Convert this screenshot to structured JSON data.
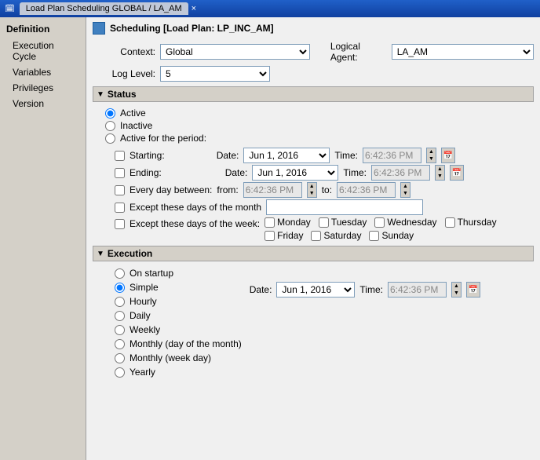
{
  "titleBar": {
    "tab": "Load Plan Scheduling GLOBAL / LA_AM",
    "closeLabel": "×"
  },
  "sidebar": {
    "sectionTitle": "Definition",
    "items": [
      {
        "id": "execution-cycle",
        "label": "Execution Cycle"
      },
      {
        "id": "variables",
        "label": "Variables"
      },
      {
        "id": "privileges",
        "label": "Privileges"
      },
      {
        "id": "version",
        "label": "Version"
      }
    ]
  },
  "pageTitle": "Scheduling [Load Plan: LP_INC_AM]",
  "form": {
    "contextLabel": "Context:",
    "contextValue": "Global",
    "logicalAgentLabel": "Logical Agent:",
    "logicalAgentValue": "LA_AM",
    "logLevelLabel": "Log Level:",
    "logLevelValue": "5"
  },
  "status": {
    "sectionTitle": "Status",
    "radioActive": "Active",
    "radioInactive": "Inactive",
    "radioActivePeriod": "Active for the period:",
    "startingLabel": "Starting:",
    "endingLabel": "Ending:",
    "everyDayLabel": "Every day between:",
    "exceptMonthLabel": "Except these days of the month",
    "exceptWeekLabel": "Except these days of the week:",
    "dateLabel": "Date:",
    "timeLabel": "Time:",
    "fromLabel": "from:",
    "toLabel": "to:",
    "dateValue": "Jun 1, 2016",
    "timeValue": "6:42:36 PM",
    "days": [
      "Monday",
      "Tuesday",
      "Wednesday",
      "Thursday",
      "Friday",
      "Saturday",
      "Sunday"
    ]
  },
  "execution": {
    "sectionTitle": "Execution",
    "options": [
      "On startup",
      "Simple",
      "Hourly",
      "Daily",
      "Weekly",
      "Monthly (day of the month)",
      "Monthly (week day)",
      "Yearly"
    ],
    "selectedOption": "Simple",
    "dateLabel": "Date:",
    "timeLabel": "Time:",
    "dateValue": "Jun 1, 2016",
    "timeValue": "6:42:36 PM"
  }
}
